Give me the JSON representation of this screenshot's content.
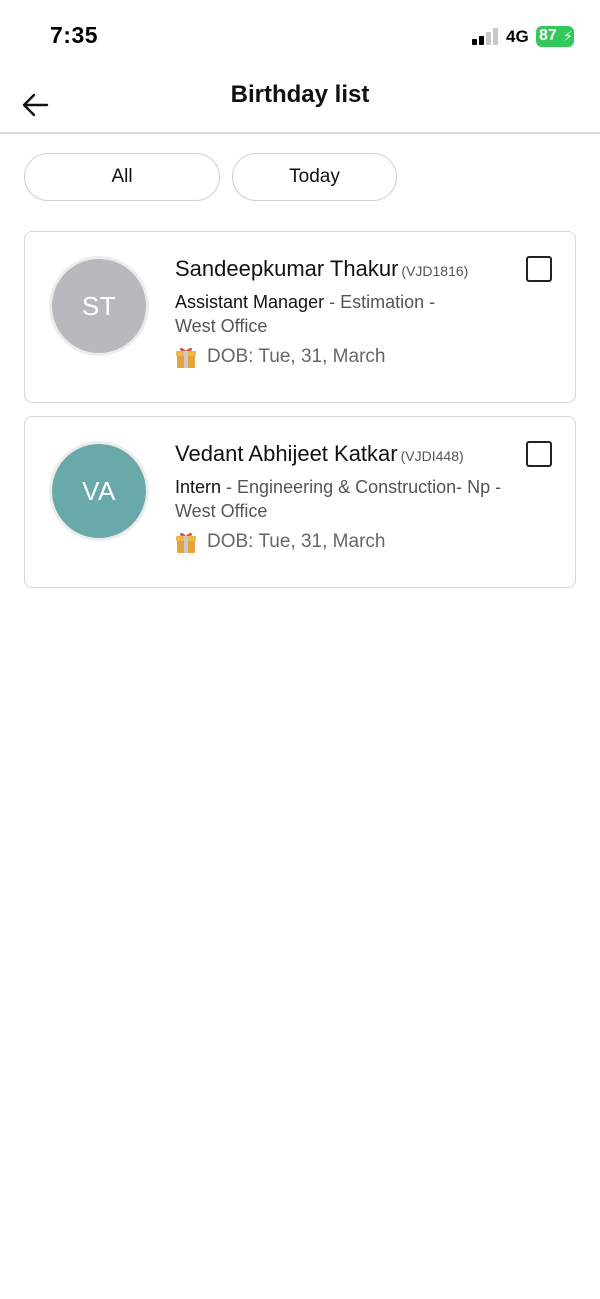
{
  "status_bar": {
    "time": "7:35",
    "network": "4G",
    "battery": "87",
    "battery_color": "#34c759"
  },
  "header": {
    "title": "Birthday list",
    "back_icon": "arrow-left-icon"
  },
  "filters": [
    {
      "label": "All"
    },
    {
      "label": "Today"
    }
  ],
  "employees": [
    {
      "initials": "ST",
      "name": "Sandeepkumar Thakur",
      "code": "(VJD1816)",
      "role": "Assistant Manager",
      "department": " - Estimation -",
      "location": "West Office",
      "dob": "DOB: Tue, 31, March",
      "avatar_color": "#b8b9bc",
      "checked": false
    },
    {
      "initials": "VA",
      "name": "Vedant Abhijeet Katkar",
      "code": "(VJDI448)",
      "role": "Intern",
      "department": " - Engineering & Construction- Np -",
      "location": "West Office",
      "dob": "DOB: Tue, 31, March",
      "avatar_color": "#6aa9a9",
      "checked": false
    }
  ],
  "icons": {
    "dob": "gift-icon",
    "select": "checkbox-icon"
  }
}
